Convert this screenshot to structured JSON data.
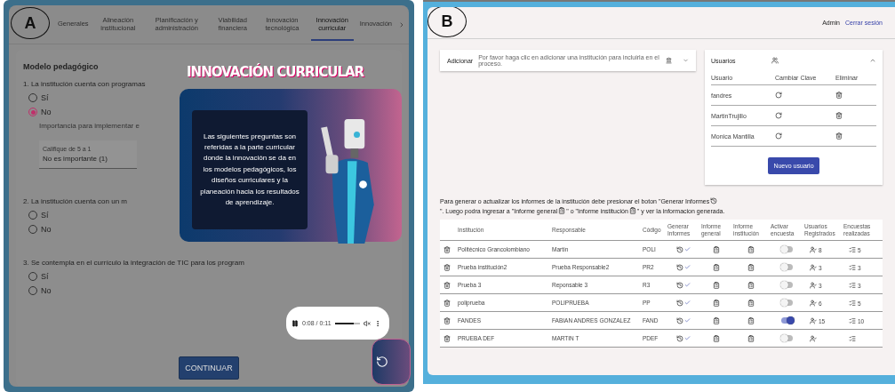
{
  "panel_a": {
    "label": "A",
    "tabs": [
      {
        "label": "Generales",
        "selected": false
      },
      {
        "label": "Alineación institucional",
        "selected": false
      },
      {
        "label": "Planificación y administración",
        "selected": false
      },
      {
        "label": "Viabilidad financiera",
        "selected": false
      },
      {
        "label": "Innovación tecnológica",
        "selected": false
      },
      {
        "label": "Innovación curricular",
        "selected": true
      },
      {
        "label": "Innovación",
        "selected": false
      }
    ],
    "section_title": "Modelo pedagógico",
    "questions": [
      {
        "text": "1. La institución cuenta con programas",
        "options": [
          {
            "label": "Sí",
            "selected": false
          },
          {
            "label": "No",
            "selected": true
          }
        ],
        "followup": {
          "label": "Importancia para implementar e",
          "field_label": "Califique de 5 a 1",
          "value": "No es importante (1)"
        }
      },
      {
        "text": "2. La institución cuenta con un m",
        "options": [
          {
            "label": "Sí",
            "selected": false
          },
          {
            "label": "No",
            "selected": false
          }
        ]
      },
      {
        "text": "3. Se contempla en el currículo la integración de TIC para los program",
        "options": [
          {
            "label": "Sí",
            "selected": false
          },
          {
            "label": "No",
            "selected": false
          }
        ]
      }
    ],
    "continue_button": "CONTINUAR",
    "intro_modal": {
      "title": "INNOVACIÓN CURRICULAR",
      "message": "Las siguientes preguntas son referidas a la parte curricular donde la innovación se da en los modelos pedagógicos, los diseños curriculares y la planeación hacia los resultados de aprendizaje.",
      "audio": {
        "time": "0:08 / 0:11",
        "level": 0.75
      }
    }
  },
  "panel_b": {
    "label": "B",
    "user": "Admin",
    "logout": "Cerrar sesión",
    "add_panel": {
      "title": "Adicionar",
      "hint": "Por favor haga clic en adicionar una institución para incluirla en el proceso.",
      "expanded": false
    },
    "users_panel": {
      "title": "Usuarios",
      "expanded": true,
      "columns": [
        "Usuario",
        "Cambiar Clave",
        "Eliminar"
      ],
      "rows": [
        {
          "name": "fandres"
        },
        {
          "name": "MartinTrujillo"
        },
        {
          "name": "Monica Mantilla"
        }
      ],
      "button": "Nuevo usuario"
    },
    "instructions": [
      "Para generar o actualizar los informes de la institución debe presionar el boton \"Generar Informes",
      "\". Luego podra ingresar a \"Informe general",
      "\" o \"Informe institución",
      "\" y ver la informacion generada."
    ],
    "table": {
      "columns": [
        "Institución",
        "Responsable",
        "Código",
        "Generar Informes",
        "Informe general",
        "Informe institución",
        "Activar encuesta",
        "Usuarios Registrados",
        "Encuestas realizadas"
      ],
      "rows": [
        {
          "institution": "Politécnico Grancolombiano",
          "responsible": "Martín",
          "code": "POLI",
          "survey_active": false,
          "users": "8",
          "surveys": "5"
        },
        {
          "institution": "Prueba institución2",
          "responsible": "Prueba Responsable2",
          "code": "PR2",
          "survey_active": false,
          "users": "3",
          "surveys": "3"
        },
        {
          "institution": "Prueba 3",
          "responsible": "Reponsable 3",
          "code": "R3",
          "survey_active": false,
          "users": "3",
          "surveys": "3"
        },
        {
          "institution": "poliprueba",
          "responsible": "POLIPRUEBA",
          "code": "PP",
          "survey_active": false,
          "users": "6",
          "surveys": "5"
        },
        {
          "institution": "FANDES",
          "responsible": "FABIAN ANDRES GONZALEZ",
          "code": "FAND",
          "survey_active": true,
          "users": "15",
          "surveys": "10"
        },
        {
          "institution": "PRUEBA DEF",
          "responsible": "MARTIN T",
          "code": "PDEF",
          "survey_active": false
        }
      ]
    }
  }
}
